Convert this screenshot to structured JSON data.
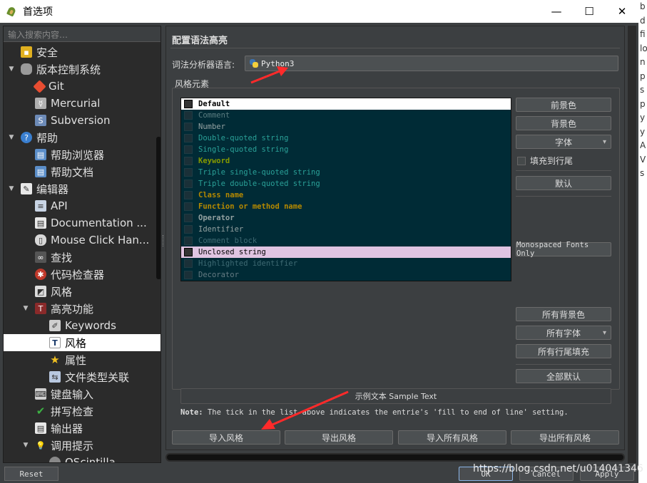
{
  "window": {
    "title": "首选项",
    "minimize": "—",
    "maximize": "☐",
    "close": "✕"
  },
  "edge_strip": [
    "b",
    "d",
    "fi",
    "lo",
    "n",
    "p",
    "s",
    "p",
    "y",
    "y",
    "A",
    "V",
    "s"
  ],
  "sidebar": {
    "search_placeholder": "输入搜索内容…",
    "items": [
      {
        "label": "安全",
        "icon": "lock-icon"
      },
      {
        "label": "版本控制系统",
        "icon": "database-icon"
      },
      {
        "label": "Git",
        "icon": "git-icon"
      },
      {
        "label": "Mercurial",
        "icon": "mercurial-icon"
      },
      {
        "label": "Subversion",
        "icon": "subversion-icon"
      },
      {
        "label": "帮助",
        "icon": "help-icon"
      },
      {
        "label": "帮助浏览器",
        "icon": "browser-icon"
      },
      {
        "label": "帮助文档",
        "icon": "document-icon"
      },
      {
        "label": "编辑器",
        "icon": "editor-icon"
      },
      {
        "label": "API",
        "icon": "api-icon"
      },
      {
        "label": "Documentation ...",
        "icon": "documentation-icon"
      },
      {
        "label": "Mouse Click Han...",
        "icon": "mouse-icon"
      },
      {
        "label": "查找",
        "icon": "binoculars-icon"
      },
      {
        "label": "代码检查器",
        "icon": "bug-icon"
      },
      {
        "label": "风格",
        "icon": "style-icon"
      },
      {
        "label": "高亮功能",
        "icon": "highlight-icon"
      },
      {
        "label": "Keywords",
        "icon": "keywords-icon"
      },
      {
        "label": "风格",
        "icon": "font-style-icon"
      },
      {
        "label": "属性",
        "icon": "star-icon"
      },
      {
        "label": "文件类型关联",
        "icon": "filetype-icon"
      },
      {
        "label": "键盘输入",
        "icon": "keyboard-icon"
      },
      {
        "label": "拼写检查",
        "icon": "spellcheck-icon"
      },
      {
        "label": "输出器",
        "icon": "exporter-icon"
      },
      {
        "label": "调用提示",
        "icon": "calltip-icon"
      },
      {
        "label": "QScintilla",
        "icon": "qscintilla-icon"
      }
    ]
  },
  "main": {
    "section_title": "配置语法高亮",
    "lexer_label": "词法分析器语言:",
    "lexer_value": "Python3",
    "group_label": "风格元素",
    "styles": [
      {
        "label": "Default",
        "color": "#000000",
        "bold": true
      },
      {
        "label": "Comment",
        "color": "#5b7c80",
        "bold": false
      },
      {
        "label": "Number",
        "color": "#93a1a1",
        "bold": false
      },
      {
        "label": "Double-quoted string",
        "color": "#2aa198",
        "bold": false
      },
      {
        "label": "Single-quoted string",
        "color": "#2aa198",
        "bold": false
      },
      {
        "label": "Keyword",
        "color": "#859900",
        "bold": true
      },
      {
        "label": "Triple single-quoted string",
        "color": "#2aa198",
        "bold": false
      },
      {
        "label": "Triple double-quoted string",
        "color": "#2aa198",
        "bold": false
      },
      {
        "label": "Class name",
        "color": "#b58900",
        "bold": true
      },
      {
        "label": "Function or method name",
        "color": "#b58900",
        "bold": true
      },
      {
        "label": "Operator",
        "color": "#93a1a1",
        "bold": true
      },
      {
        "label": "Identifier",
        "color": "#93a1a1",
        "bold": false
      },
      {
        "label": "Comment block",
        "color": "#3e6a73",
        "bold": false
      },
      {
        "label": "Unclosed string",
        "color": "#000000",
        "bold": false
      },
      {
        "label": "Highlighted identifier",
        "color": "#3e6a73",
        "bold": false
      },
      {
        "label": "Decorator",
        "color": "#657b83",
        "bold": false
      }
    ],
    "buttons": {
      "foreground": "前景色",
      "background": "背景色",
      "font": "字体",
      "fill_to_eol": "填充到行尾",
      "default": "默认",
      "monospaced": "Monospaced Fonts Only",
      "all_background": "所有背景色",
      "all_fonts": "所有字体",
      "all_eol_fill": "所有行尾填充",
      "all_default": "全部默认"
    },
    "sample_text": "示例文本 Sample Text",
    "note_label": "Note:",
    "note_text": " The tick in the list above indicates the entrie's 'fill to end of line' setting.",
    "bottom_buttons": {
      "import_style": "导入风格",
      "export_style": "导出风格",
      "import_all": "导入所有风格",
      "export_all": "导出所有风格"
    }
  },
  "dialog": {
    "reset": "Reset",
    "ok": "OK",
    "cancel": "Cancel",
    "apply": "Apply"
  },
  "watermark": "https://blog.csdn.net/u014041346",
  "colors": {
    "list_bg": "#002b36",
    "annotation_arrow": "#ff2a2a",
    "unclosed_bg": "#e0c4e2"
  }
}
